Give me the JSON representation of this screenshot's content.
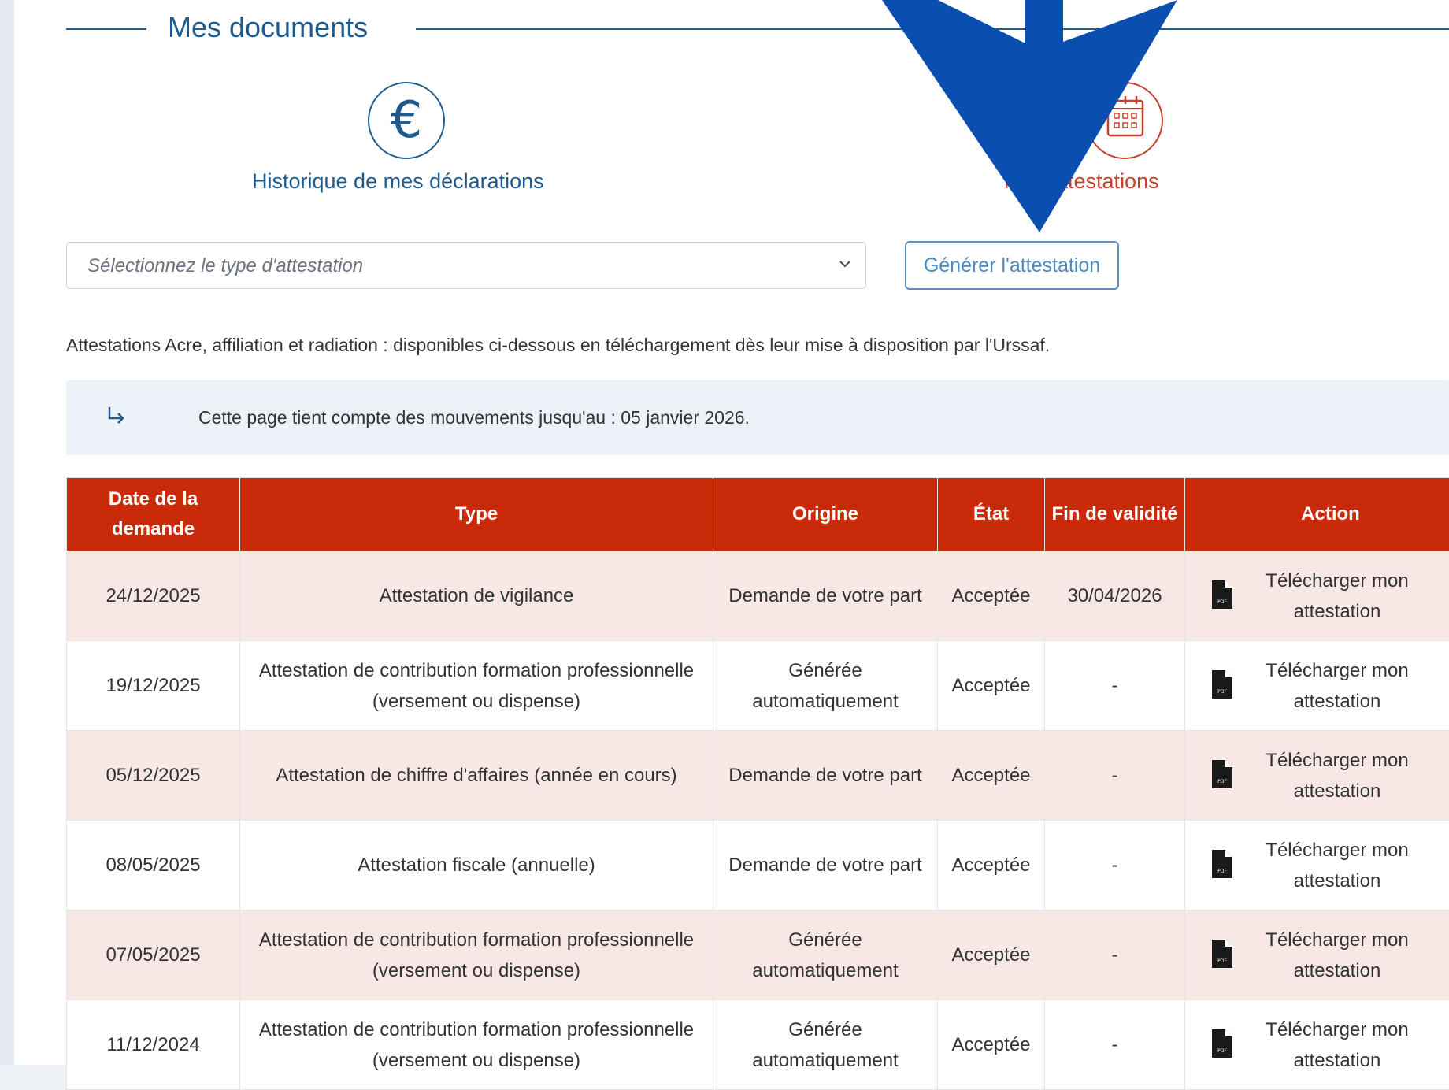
{
  "section": {
    "title": "Mes documents"
  },
  "tiles": {
    "history": {
      "icon": "euro-icon",
      "symbol": "€",
      "label": "Historique de mes déclarations",
      "color": "#1f5b8f"
    },
    "certificates": {
      "icon": "calendar-icon",
      "label": "Mes attestations",
      "color": "#c8402b"
    }
  },
  "form": {
    "select_placeholder": "Sélectionnez le type d'attestation",
    "generate_label": "Générer l'attestation"
  },
  "info_text": "Attestations Acre, affiliation et radiation : disponibles ci-dessous en téléchargement dès leur mise à disposition par l'Urssaf.",
  "notice": {
    "icon": "return-arrow-icon",
    "text": "Cette page tient compte des mouvements jusqu'au : 05 janvier 2026."
  },
  "table": {
    "headers": {
      "date": "Date de la demande",
      "type": "Type",
      "origin": "Origine",
      "state": "État",
      "end": "Fin de validité",
      "action": "Action"
    },
    "header_color": "#c92a0a",
    "rows": [
      {
        "date": "24/12/2025",
        "type": "Attestation de vigilance",
        "origin": "Demande de votre part",
        "state": "Acceptée",
        "end": "30/04/2026",
        "action": "Télécharger mon attestation"
      },
      {
        "date": "19/12/2025",
        "type": "Attestation de contribution formation professionnelle (versement ou dispense)",
        "origin": "Générée automatiquement",
        "state": "Acceptée",
        "end": "-",
        "action": "Télécharger mon attestation"
      },
      {
        "date": "05/12/2025",
        "type": "Attestation de chiffre d'affaires (année en cours)",
        "origin": "Demande de votre part",
        "state": "Acceptée",
        "end": "-",
        "action": "Télécharger mon attestation"
      },
      {
        "date": "08/05/2025",
        "type": "Attestation fiscale (annuelle)",
        "origin": "Demande de votre part",
        "state": "Acceptée",
        "end": "-",
        "action": "Télécharger mon attestation"
      },
      {
        "date": "07/05/2025",
        "type": "Attestation de contribution formation professionnelle (versement ou dispense)",
        "origin": "Générée automatiquement",
        "state": "Acceptée",
        "end": "-",
        "action": "Télécharger mon attestation"
      },
      {
        "date": "11/12/2024",
        "type": "Attestation de contribution formation professionnelle (versement ou dispense)",
        "origin": "Générée automatiquement",
        "state": "Acceptée",
        "end": "-",
        "action": "Télécharger mon attestation"
      }
    ]
  },
  "overlay": {
    "icon": "down-arrow-icon",
    "color": "#0a4fb0"
  }
}
